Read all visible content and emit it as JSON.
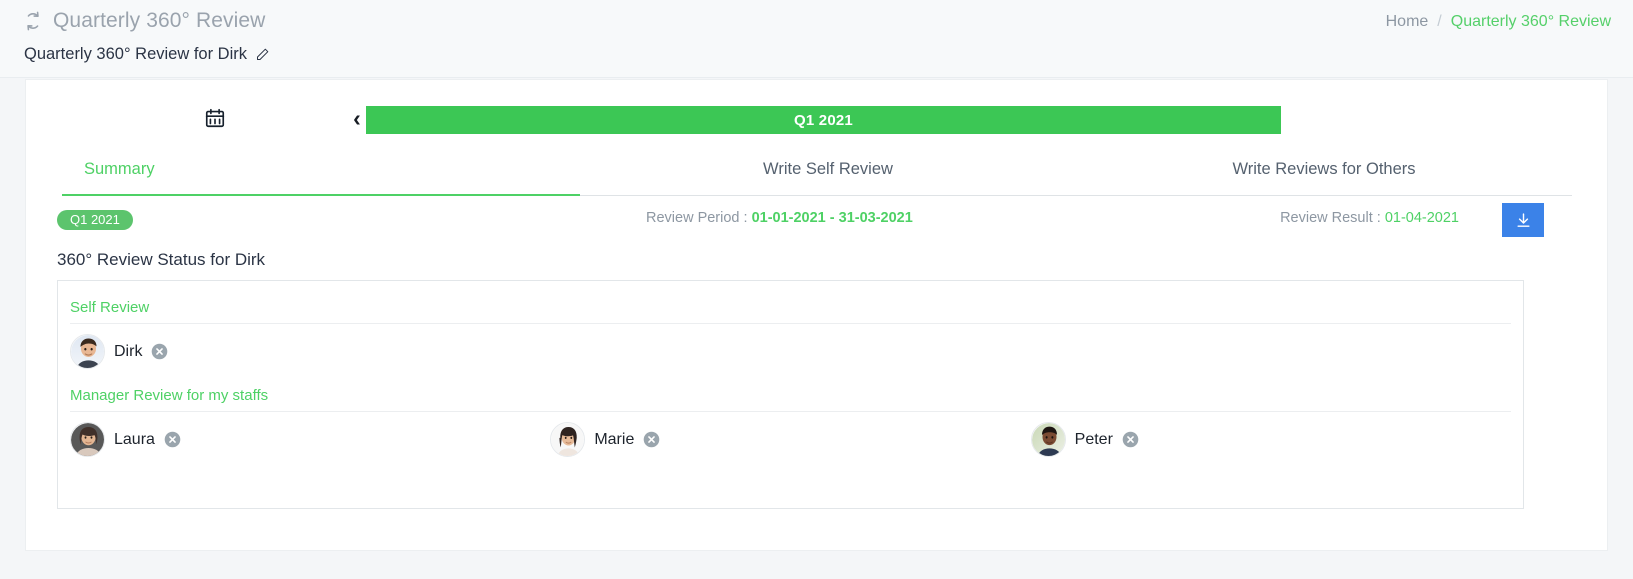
{
  "header": {
    "app_icon": "cycle-icon",
    "app_title": "Quarterly 360° Review",
    "page_title": "Quarterly 360° Review for Dirk",
    "edit_icon": "pencil-icon",
    "breadcrumb": {
      "home": "Home",
      "separator": "/",
      "current": "Quarterly 360° Review"
    }
  },
  "quarter_selector": {
    "calendar_icon": "calendar-icon",
    "prev_icon": "chevron-left-icon",
    "prev_label": "‹",
    "current_quarter": "Q1 2021"
  },
  "tabs": [
    {
      "label": "Summary",
      "active": true
    },
    {
      "label": "Write Self Review",
      "active": false
    },
    {
      "label": "Write Reviews for Others",
      "active": false
    }
  ],
  "meta": {
    "quarter_badge": "Q1 2021",
    "review_period_label": "Review Period : ",
    "review_period_value": "01-01-2021 - 31-03-2021",
    "review_result_label": "Review Result : ",
    "review_result_value": "01-04-2021",
    "download_icon": "download-icon"
  },
  "status": {
    "heading": "360° Review Status for Dirk",
    "sections": [
      {
        "label": "Self Review",
        "people": [
          {
            "name": "Dirk",
            "status_icon": "x-circle-icon",
            "avatar": "avatar-dirk"
          }
        ]
      },
      {
        "label": "Manager Review for my staffs",
        "people": [
          {
            "name": "Laura",
            "status_icon": "x-circle-icon",
            "avatar": "avatar-laura"
          },
          {
            "name": "Marie",
            "status_icon": "x-circle-icon",
            "avatar": "avatar-marie"
          },
          {
            "name": "Peter",
            "status_icon": "x-circle-icon",
            "avatar": "avatar-peter"
          }
        ]
      }
    ]
  },
  "colors": {
    "green": "#3cc755",
    "green_text": "#4ed165",
    "blue": "#3b82e8",
    "muted": "#8d97a2",
    "status_gray": "#9aa5ad"
  }
}
